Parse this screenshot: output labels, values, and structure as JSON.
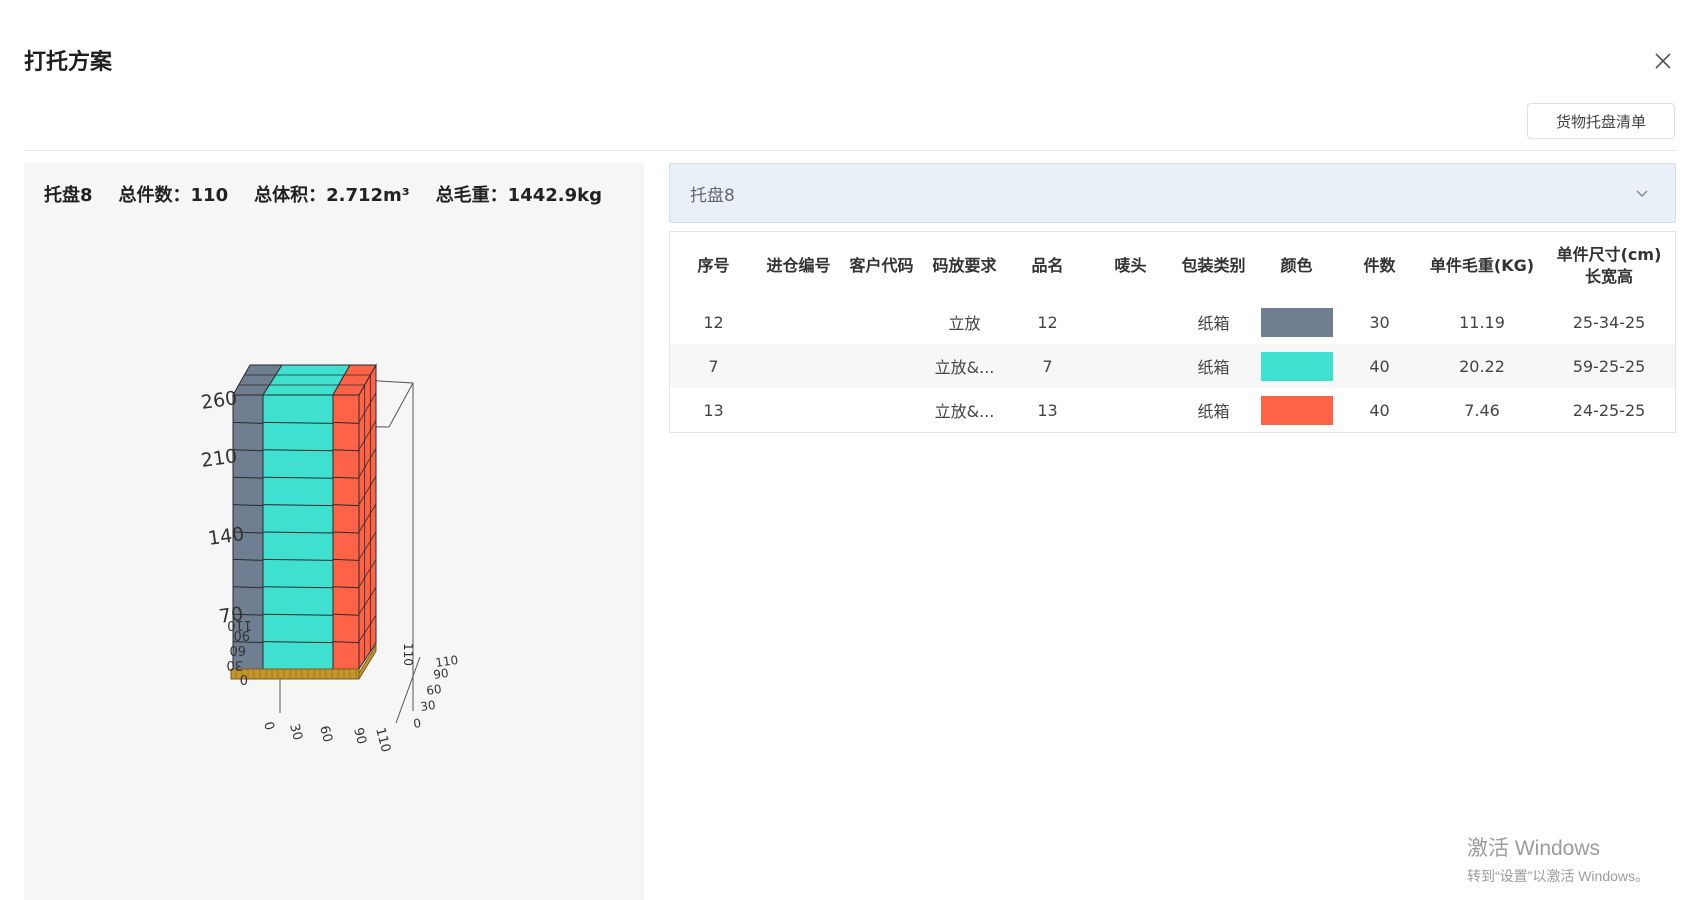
{
  "dialog": {
    "title": "打托方案",
    "list_button": "货物托盘清单"
  },
  "summary": {
    "pallet": "托盘8",
    "total_pieces": "总件数：110",
    "total_volume": "总体积：2.712m³",
    "total_weight": "总毛重：1442.9kg"
  },
  "viz": {
    "z_ticks": [
      "260",
      "210",
      "140",
      "70"
    ],
    "left_ticks": [
      "0",
      "30",
      "60",
      "90",
      "110"
    ],
    "front_ticks": [
      "0",
      "30",
      "60",
      "90",
      "110"
    ],
    "right_ticks": [
      "0",
      "30",
      "60",
      "90",
      "110"
    ],
    "colors": {
      "gray": "#6f7f91",
      "teal": "#40e0d0",
      "red": "#ff6347",
      "pallet": "#c4962e"
    }
  },
  "select": {
    "value": "托盘8"
  },
  "table": {
    "headers": [
      "序号",
      "进仓编号",
      "客户代码",
      "码放要求",
      "品名",
      "唛头",
      "包装类别",
      "颜色",
      "件数",
      "单件毛重(KG)",
      "单件尺寸(cm)\n长宽高"
    ],
    "rows": [
      {
        "seq": "12",
        "entry_no": "",
        "customer_code": "",
        "stacking": "立放",
        "product": "12",
        "mark": "",
        "package": "纸箱",
        "color": "#6f7f91",
        "qty": "30",
        "unit_weight": "11.19",
        "size": "25-34-25"
      },
      {
        "seq": "7",
        "entry_no": "",
        "customer_code": "",
        "stacking": "立放&...",
        "product": "7",
        "mark": "",
        "package": "纸箱",
        "color": "#40e0d0",
        "qty": "40",
        "unit_weight": "20.22",
        "size": "59-25-25"
      },
      {
        "seq": "13",
        "entry_no": "",
        "customer_code": "",
        "stacking": "立放&...",
        "product": "13",
        "mark": "",
        "package": "纸箱",
        "color": "#ff6347",
        "qty": "40",
        "unit_weight": "7.46",
        "size": "24-25-25"
      }
    ]
  },
  "watermark": {
    "line1": "激活 Windows",
    "line2": "转到“设置”以激活 Windows。"
  }
}
